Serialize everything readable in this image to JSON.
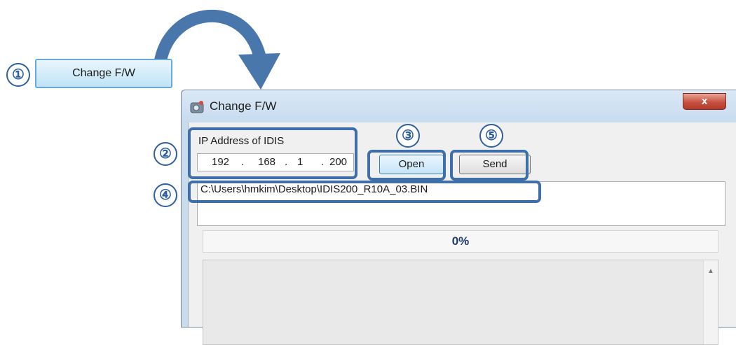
{
  "launcher": {
    "button_label": "Change F/W"
  },
  "steps": [
    "①",
    "②",
    "③",
    "④",
    "⑤"
  ],
  "window": {
    "title": "Change F/W",
    "close_label": "x",
    "ip_label": "IP Address of IDIS",
    "ip": {
      "octet1": "192",
      "octet2": "168",
      "octet3": "1",
      "octet4": "200",
      "sep": "."
    },
    "open_label": "Open",
    "send_label": "Send",
    "file_path": "C:\\Users\\hmkim\\Desktop\\IDIS200_R10A_03.BIN",
    "progress": "0%",
    "progress_value": 0
  },
  "colors": {
    "highlight": "#3e6fa8",
    "arrow": "#4a77ab",
    "title_bg": "#c9dcee"
  }
}
